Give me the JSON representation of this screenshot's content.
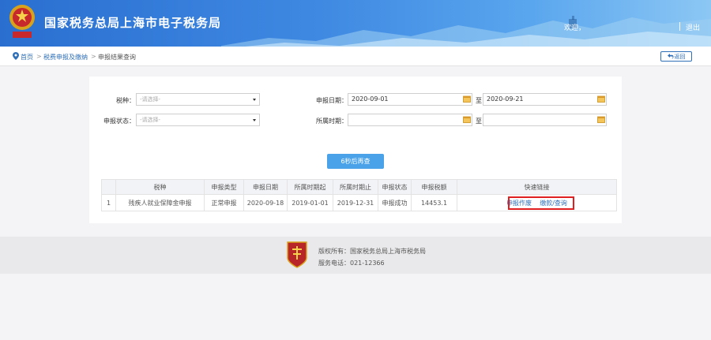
{
  "header": {
    "title": "国家税务总局上海市电子税务局",
    "welcome": "欢迎，",
    "logout": "退出"
  },
  "breadcrumb": {
    "home": "首页",
    "parent": "税费申报及缴纳",
    "current": "申报结果查询",
    "separator": ">",
    "back": "返回"
  },
  "form": {
    "tax_type_label": "税种：",
    "tax_type_placeholder": "-请选择-",
    "status_label": "申报状态：",
    "status_placeholder": "-请选择-",
    "declare_date_label": "申报日期：",
    "declare_date_from": "2020-09-01",
    "declare_date_to": "2020-09-21",
    "period_label": "所属时期：",
    "period_from": "",
    "period_to": "",
    "to_label": "至",
    "submit_label": "6秒后再查"
  },
  "table": {
    "headers": [
      "",
      "税种",
      "申报类型",
      "申报日期",
      "所属时期起",
      "所属时期止",
      "申报状态",
      "申报税额",
      "快速链接"
    ],
    "rows": [
      {
        "index": "1",
        "tax_type": "残疾人就业保障金申报",
        "declare_type": "正常申报",
        "declare_date": "2020-09-18",
        "period_start": "2019-01-01",
        "period_end": "2019-12-31",
        "status": "申报成功",
        "amount": "14453.1",
        "link_void": "申报作废",
        "link_pay": "缴款/查询"
      }
    ]
  },
  "footer": {
    "copyright": "版权所有：国家税务总局上海市税务局",
    "phone": "服务电话：021-12366"
  },
  "colors": {
    "header_blue": "#3f89e2",
    "link_blue": "#2f6fb7",
    "button_blue": "#4aa3e8",
    "highlight_red": "#e02020"
  }
}
